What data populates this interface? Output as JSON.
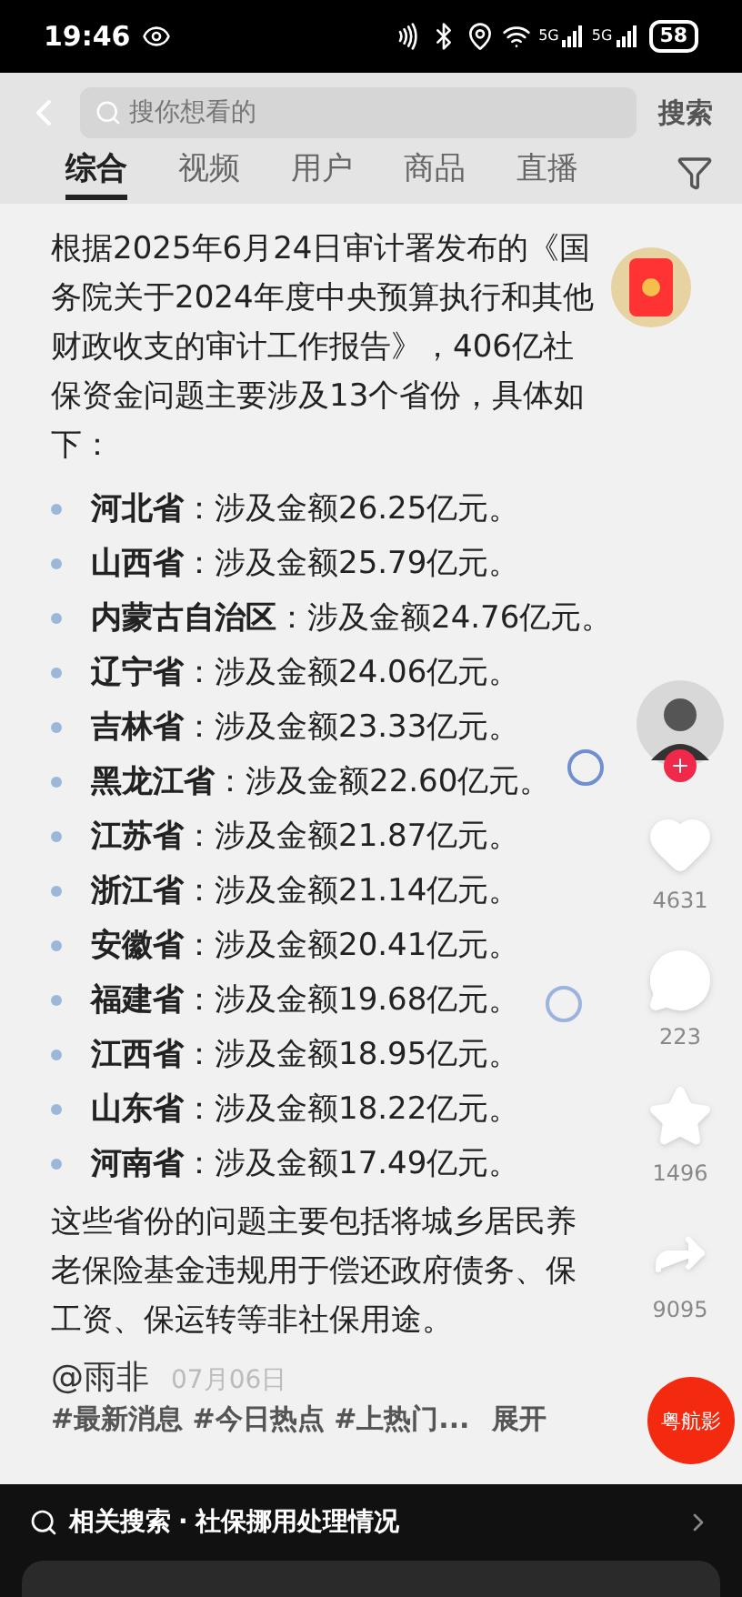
{
  "status_bar": {
    "time": "19:46",
    "network_1": "5G",
    "network_2": "5G",
    "battery": "58"
  },
  "search": {
    "placeholder": "搜你想看的",
    "button": "搜索"
  },
  "tabs": [
    {
      "label": "综合",
      "selected": true
    },
    {
      "label": "视频",
      "selected": false
    },
    {
      "label": "用户",
      "selected": false
    },
    {
      "label": "商品",
      "selected": false
    },
    {
      "label": "直播",
      "selected": false
    }
  ],
  "intro": "根据2025年6月24日审计署发布的《国务院关于2024年度中央预算执行和其他财政收支的审计工作报告》，406亿社保资金问题主要涉及13个省份，具体如下：",
  "provinces": [
    {
      "name": "河北省",
      "detail": "：涉及金额26.25亿元。"
    },
    {
      "name": "山西省",
      "detail": "：涉及金额25.79亿元。"
    },
    {
      "name": "内蒙古自治区",
      "detail": "：涉及金额24.76亿元。"
    },
    {
      "name": "辽宁省",
      "detail": "：涉及金额24.06亿元。"
    },
    {
      "name": "吉林省",
      "detail": "：涉及金额23.33亿元。"
    },
    {
      "name": "黑龙江省",
      "detail": "：涉及金额22.60亿元。"
    },
    {
      "name": "江苏省",
      "detail": "：涉及金额21.87亿元。"
    },
    {
      "name": "浙江省",
      "detail": "：涉及金额21.14亿元。"
    },
    {
      "name": "安徽省",
      "detail": "：涉及金额20.41亿元。"
    },
    {
      "name": "福建省",
      "detail": "：涉及金额19.68亿元。"
    },
    {
      "name": "江西省",
      "detail": "：涉及金额18.95亿元。"
    },
    {
      "name": "山东省",
      "detail": "：涉及金额18.22亿元。"
    },
    {
      "name": "河南省",
      "detail": "：涉及金额17.49亿元。"
    }
  ],
  "closing": "这些省份的问题主要包括将城乡居民养老保险基金违规用于偿还政府债务、保工资、保运转等非社保用途。",
  "actions": [
    {
      "kind": "like",
      "count": "4631"
    },
    {
      "kind": "comment",
      "count": "223"
    },
    {
      "kind": "favorite",
      "count": "1496"
    },
    {
      "kind": "share",
      "count": "9095"
    }
  ],
  "author": "@雨非",
  "date": "07月06日",
  "hashtags": "#最新消息 #今日热点 #上热门...",
  "expand": "展开",
  "floating_button": "粤航影",
  "related_search": {
    "label": "相关搜索",
    "separator": "·",
    "query": "社保挪用处理情况"
  }
}
